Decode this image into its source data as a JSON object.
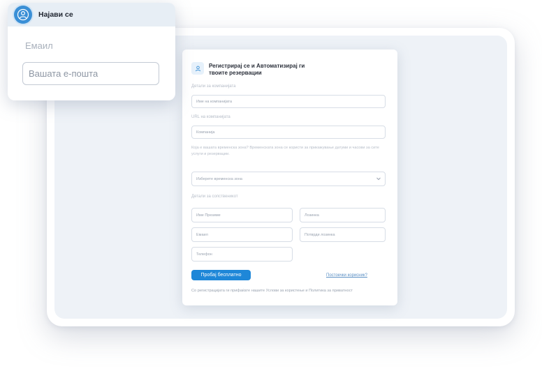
{
  "login": {
    "title": "Најави се",
    "email_label": "Емаил",
    "email_placeholder": "Вашата е-пошта"
  },
  "form": {
    "title": "Регистрирај се и Автоматизирај ги твоите резервации",
    "company_details_label": "Детали за компанијата",
    "company_name_placeholder": "Име на компанијата",
    "company_url_label": "URL на компанијата",
    "company_url_placeholder": "Компанија",
    "timezone_help": "Која е вашата временска зона? Временската зона се користи за прикажување датуми и часови за сите услуги и резервации.",
    "timezone_placeholder": "Изберете временска зона",
    "owner_details_label": "Детали за сопственикот",
    "first_name_placeholder": "Име Презиме",
    "last_name_placeholder": "Лозинка",
    "email_placeholder": "Емаил",
    "confirm_password_placeholder": "Потврди лозинка",
    "phone_placeholder": "Телефон",
    "submit_label": "Пробај бесплатно",
    "existing_user_link": "Постоечки корисник?",
    "terms_text": "Со регистрацијата ги прифаќате нашите Услови за користење и Политика за приватност"
  },
  "colors": {
    "accent": "#1e87d8",
    "screen_bg": "#eef2f7"
  },
  "icons": [
    "user-icon",
    "avatar-icon",
    "chevron-down-icon"
  ]
}
